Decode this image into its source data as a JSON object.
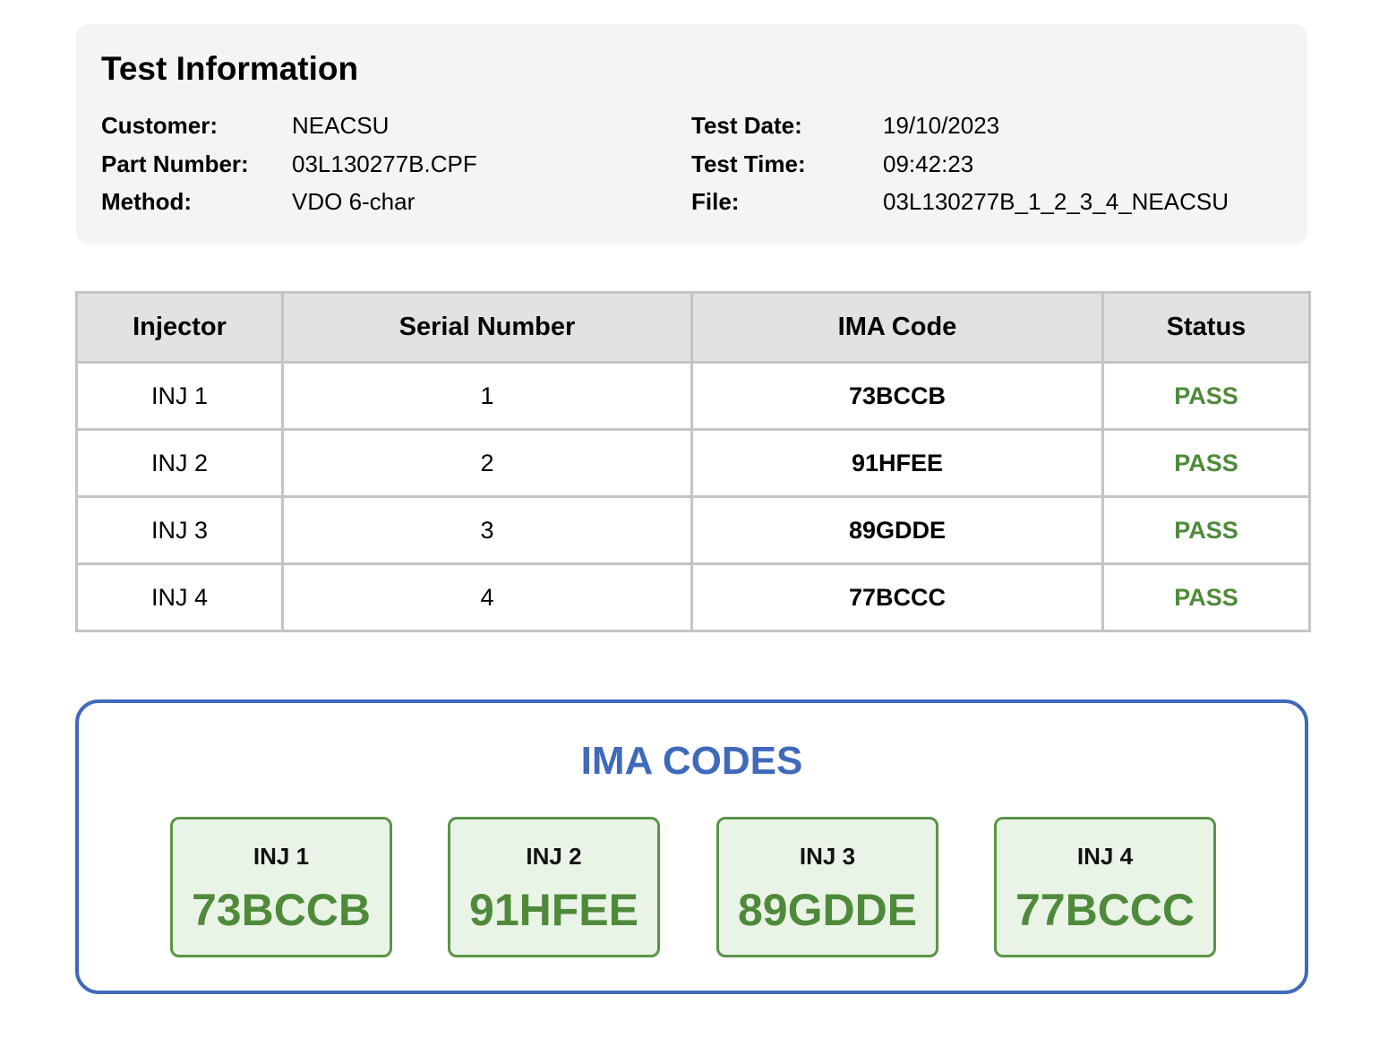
{
  "info": {
    "title": "Test Information",
    "customer_label": "Customer:",
    "customer_value": "NEACSU",
    "part_number_label": "Part Number:",
    "part_number_value": "03L130277B.CPF",
    "method_label": "Method:",
    "method_value": "VDO 6-char",
    "test_date_label": "Test Date:",
    "test_date_value": "19/10/2023",
    "test_time_label": "Test Time:",
    "test_time_value": "09:42:23",
    "file_label": "File:",
    "file_value": "03L130277B_1_2_3_4_NEACSU"
  },
  "table": {
    "headers": [
      "Injector",
      "Serial Number",
      "IMA Code",
      "Status"
    ],
    "rows": [
      {
        "injector": "INJ 1",
        "serial": "1",
        "ima": "73BCCB",
        "status": "PASS"
      },
      {
        "injector": "INJ 2",
        "serial": "2",
        "ima": "91HFEE",
        "status": "PASS"
      },
      {
        "injector": "INJ 3",
        "serial": "3",
        "ima": "89GDDE",
        "status": "PASS"
      },
      {
        "injector": "INJ 4",
        "serial": "4",
        "ima": "77BCCC",
        "status": "PASS"
      }
    ]
  },
  "codes": {
    "title": "IMA CODES",
    "cards": [
      {
        "label": "INJ 1",
        "code": "73BCCB"
      },
      {
        "label": "INJ 2",
        "code": "91HFEE"
      },
      {
        "label": "INJ 3",
        "code": "89GDDE"
      },
      {
        "label": "INJ 4",
        "code": "77BCCC"
      }
    ]
  },
  "colors": {
    "pass_green": "#4f8a3a",
    "accent_blue": "#3f6abb",
    "card_background": "#e9f4e7",
    "panel_background": "#f4f4f4"
  }
}
